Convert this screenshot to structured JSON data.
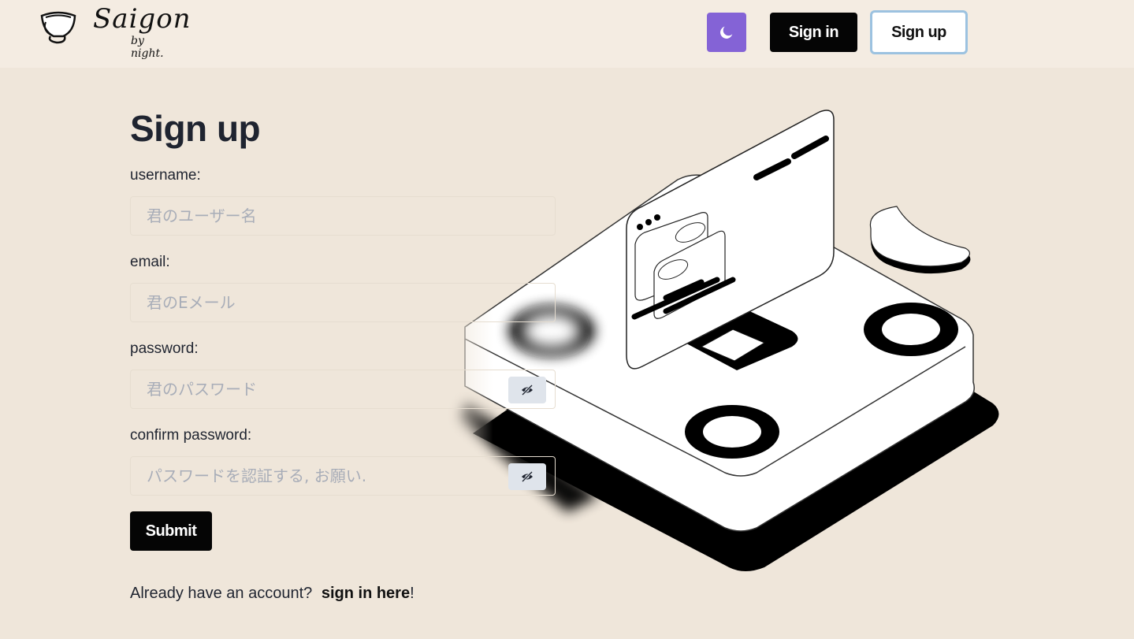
{
  "header": {
    "logo_main": "Saigon",
    "logo_sub": "by night.",
    "theme_icon": "moon-icon",
    "signin_label": "Sign in",
    "signup_label": "Sign up"
  },
  "form": {
    "title": "Sign up",
    "username_label": "username:",
    "username_placeholder": "君のユーザー名",
    "email_label": "email:",
    "email_placeholder": "君のEメール",
    "password_label": "password:",
    "password_placeholder": "君のパスワード",
    "confirm_label": "confirm password:",
    "confirm_placeholder": "パスワードを認証する, お願い.",
    "eye_icon": "eye-off-icon",
    "submit_label": "Submit"
  },
  "footer": {
    "already_text": "Already have an account?",
    "signin_link": "sign in here",
    "exclaim": "!"
  },
  "colors": {
    "page_bg": "#efe6da",
    "header_bg": "#f4ece2",
    "theme_button": "#8463d6",
    "signup_border": "#9cc2e0"
  }
}
